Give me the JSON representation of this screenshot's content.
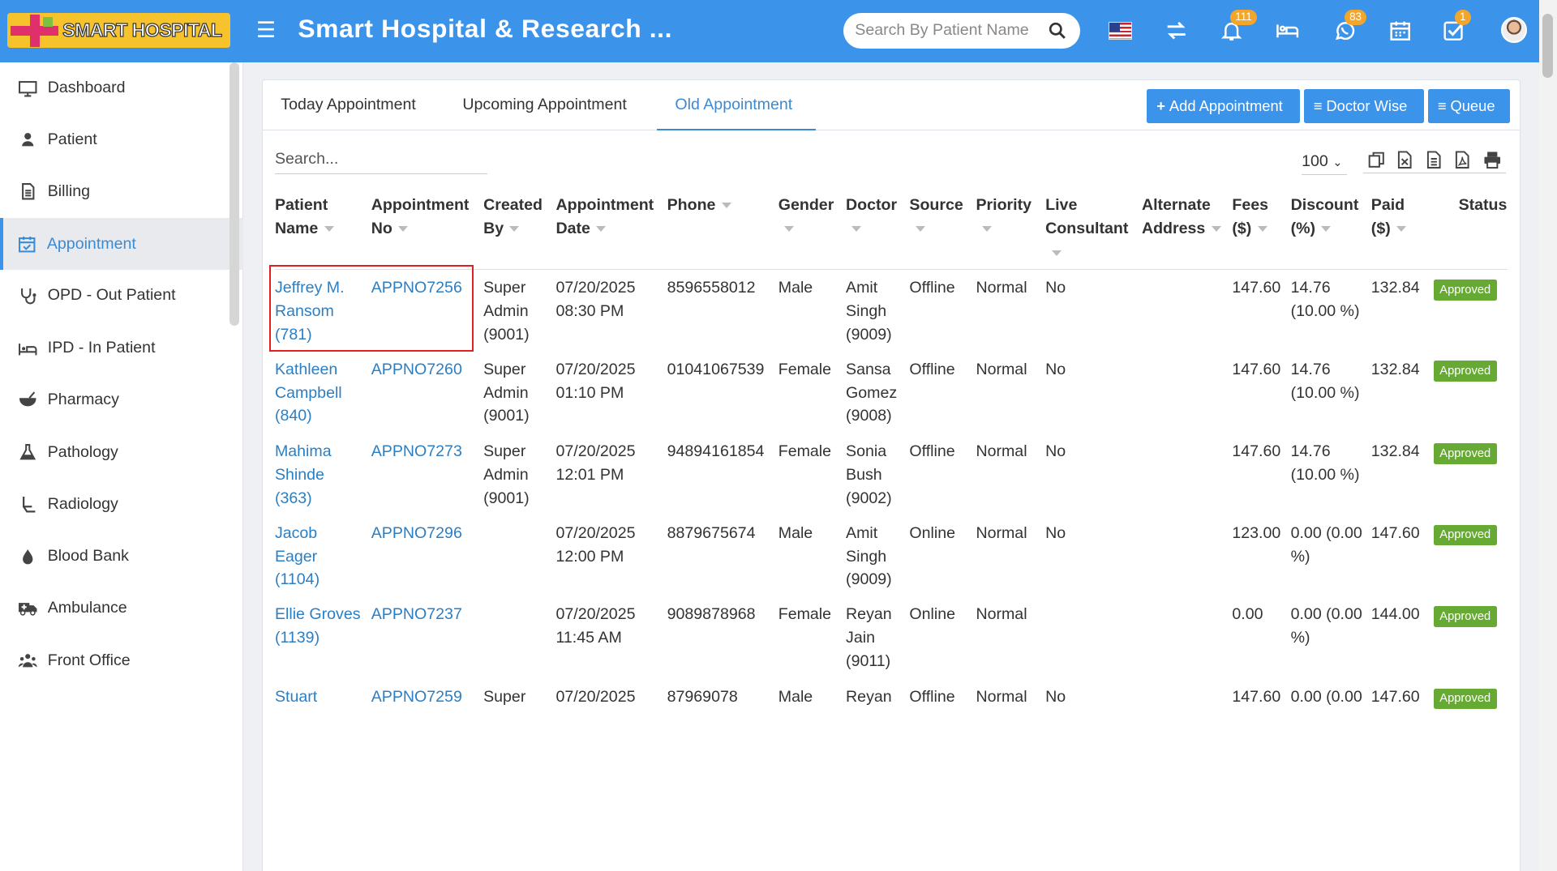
{
  "header": {
    "logo_text": "SMART HOSPITAL",
    "title": "Smart Hospital & Research ...",
    "search_placeholder": "Search By Patient Name",
    "notifications_badge": "111",
    "whatsapp_badge": "83",
    "tasks_badge": "1"
  },
  "sidebar": {
    "items": [
      {
        "label": "Dashboard",
        "icon": "monitor-icon"
      },
      {
        "label": "Patient",
        "icon": "user-icon"
      },
      {
        "label": "Billing",
        "icon": "file-icon"
      },
      {
        "label": "Appointment",
        "icon": "calendar-check-icon"
      },
      {
        "label": "OPD - Out Patient",
        "icon": "stethoscope-icon"
      },
      {
        "label": "IPD - In Patient",
        "icon": "bed-icon"
      },
      {
        "label": "Pharmacy",
        "icon": "mortar-icon"
      },
      {
        "label": "Pathology",
        "icon": "flask-icon"
      },
      {
        "label": "Radiology",
        "icon": "xray-icon"
      },
      {
        "label": "Blood Bank",
        "icon": "drop-icon"
      },
      {
        "label": "Ambulance",
        "icon": "ambulance-icon"
      },
      {
        "label": "Front Office",
        "icon": "users-icon"
      }
    ]
  },
  "tabs": [
    {
      "label": "Today Appointment"
    },
    {
      "label": "Upcoming Appointment"
    },
    {
      "label": "Old Appointment"
    }
  ],
  "buttons": {
    "add": "Add Appointment",
    "doctor_wise": "Doctor Wise",
    "queue": "Queue"
  },
  "table": {
    "search_placeholder": "Search...",
    "page_size": "100",
    "columns": [
      {
        "line1": "Patient",
        "line2": "Name"
      },
      {
        "line1": "Appointment",
        "line2": "No"
      },
      {
        "line1": "Created",
        "line2": "By"
      },
      {
        "line1": "Appointment",
        "line2": "Date"
      },
      {
        "line1": "Phone",
        "line2": ""
      },
      {
        "line1": "Gender",
        "line2": ""
      },
      {
        "line1": "Doctor",
        "line2": ""
      },
      {
        "line1": "Source",
        "line2": ""
      },
      {
        "line1": "Priority",
        "line2": ""
      },
      {
        "line1": "Live",
        "line2": "Consultant"
      },
      {
        "line1": "Alternate",
        "line2": "Address"
      },
      {
        "line1": "Fees",
        "line2": "($)"
      },
      {
        "line1": "Discount",
        "line2": "(%)"
      },
      {
        "line1": "Paid",
        "line2": "($)"
      },
      {
        "line1": "Status",
        "line2": ""
      }
    ],
    "rows": [
      {
        "name": [
          "Jeffrey M.",
          "Ransom",
          "(781)"
        ],
        "appt": "APPNO7256",
        "created": [
          "Super",
          "Admin",
          "(9001)"
        ],
        "date": [
          "07/20/2025",
          "08:30 PM"
        ],
        "phone": "8596558012",
        "gender": "Male",
        "doctor": [
          "Amit",
          "Singh",
          "(9009)"
        ],
        "source": "Offline",
        "priority": "Normal",
        "live": "No",
        "fees": "147.60",
        "discount": [
          "14.76",
          "(10.00 %)"
        ],
        "paid": "132.84",
        "status": "Approved"
      },
      {
        "name": [
          "Kathleen",
          "Campbell",
          "(840)"
        ],
        "appt": "APPNO7260",
        "created": [
          "Super",
          "Admin",
          "(9001)"
        ],
        "date": [
          "07/20/2025",
          "01:10 PM"
        ],
        "phone": "01041067539",
        "gender": "Female",
        "doctor": [
          "Sansa",
          "Gomez",
          "(9008)"
        ],
        "source": "Offline",
        "priority": "Normal",
        "live": "No",
        "fees": "147.60",
        "discount": [
          "14.76",
          "(10.00 %)"
        ],
        "paid": "132.84",
        "status": "Approved"
      },
      {
        "name": [
          "Mahima",
          "Shinde",
          "(363)"
        ],
        "appt": "APPNO7273",
        "created": [
          "Super",
          "Admin",
          "(9001)"
        ],
        "date": [
          "07/20/2025",
          "12:01 PM"
        ],
        "phone": "94894161854",
        "gender": "Female",
        "doctor": [
          "Sonia",
          "Bush",
          "(9002)"
        ],
        "source": "Offline",
        "priority": "Normal",
        "live": "No",
        "fees": "147.60",
        "discount": [
          "14.76",
          "(10.00 %)"
        ],
        "paid": "132.84",
        "status": "Approved"
      },
      {
        "name": [
          "Jacob",
          "Eager",
          "(1104)"
        ],
        "appt": "APPNO7296",
        "created": [
          "",
          "",
          ""
        ],
        "date": [
          "07/20/2025",
          "12:00 PM"
        ],
        "phone": "8879675674",
        "gender": "Male",
        "doctor": [
          "Amit",
          "Singh",
          "(9009)"
        ],
        "source": "Online",
        "priority": "Normal",
        "live": "No",
        "fees": "123.00",
        "discount": [
          "0.00 (0.00",
          "%)"
        ],
        "paid": "147.60",
        "status": "Approved"
      },
      {
        "name": [
          "Ellie Groves",
          "(1139)",
          ""
        ],
        "appt": "APPNO7237",
        "created": [
          "",
          "",
          ""
        ],
        "date": [
          "07/20/2025",
          "11:45 AM"
        ],
        "phone": "9089878968",
        "gender": "Female",
        "doctor": [
          "Reyan",
          "Jain",
          "(9011)"
        ],
        "source": "Online",
        "priority": "Normal",
        "live": "",
        "fees": "0.00",
        "discount": [
          "0.00 (0.00",
          "%)"
        ],
        "paid": "144.00",
        "status": "Approved"
      },
      {
        "name": [
          "Stuart",
          "",
          ""
        ],
        "appt": "APPNO7259",
        "created": [
          "Super",
          "",
          ""
        ],
        "date": [
          "07/20/2025",
          ""
        ],
        "phone": "87969078",
        "gender": "Male",
        "doctor": [
          "Reyan",
          "",
          ""
        ],
        "source": "Offline",
        "priority": "Normal",
        "live": "No",
        "fees": "147.60",
        "discount": [
          "0.00 (0.00",
          ""
        ],
        "paid": "147.60",
        "status": "Approved"
      }
    ]
  }
}
